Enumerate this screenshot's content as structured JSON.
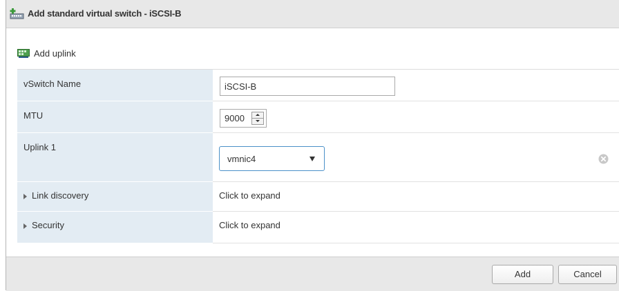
{
  "dialog": {
    "title": "Add standard virtual switch - iSCSI-B"
  },
  "toolbar": {
    "add_uplink_label": "Add uplink"
  },
  "form": {
    "vswitch_name": {
      "label": "vSwitch Name",
      "value": "iSCSI-B"
    },
    "mtu": {
      "label": "MTU",
      "value": "9000"
    },
    "uplink1": {
      "label": "Uplink 1",
      "selected": "vmnic4"
    },
    "link_discovery": {
      "label": "Link discovery",
      "value": "Click to expand"
    },
    "security": {
      "label": "Security",
      "value": "Click to expand"
    }
  },
  "footer": {
    "add_label": "Add",
    "cancel_label": "Cancel"
  },
  "icons": {
    "title": "add-vswitch-icon",
    "add_uplink": "nic-add-icon",
    "remove_uplink": "remove-circle-icon",
    "select_caret": "caret-down-icon",
    "expand": "caret-right-icon"
  },
  "colors": {
    "label_column_bg": "#e3ecf3",
    "titlebar_bg": "#e8e8e8",
    "select_border": "#4a90c8"
  }
}
